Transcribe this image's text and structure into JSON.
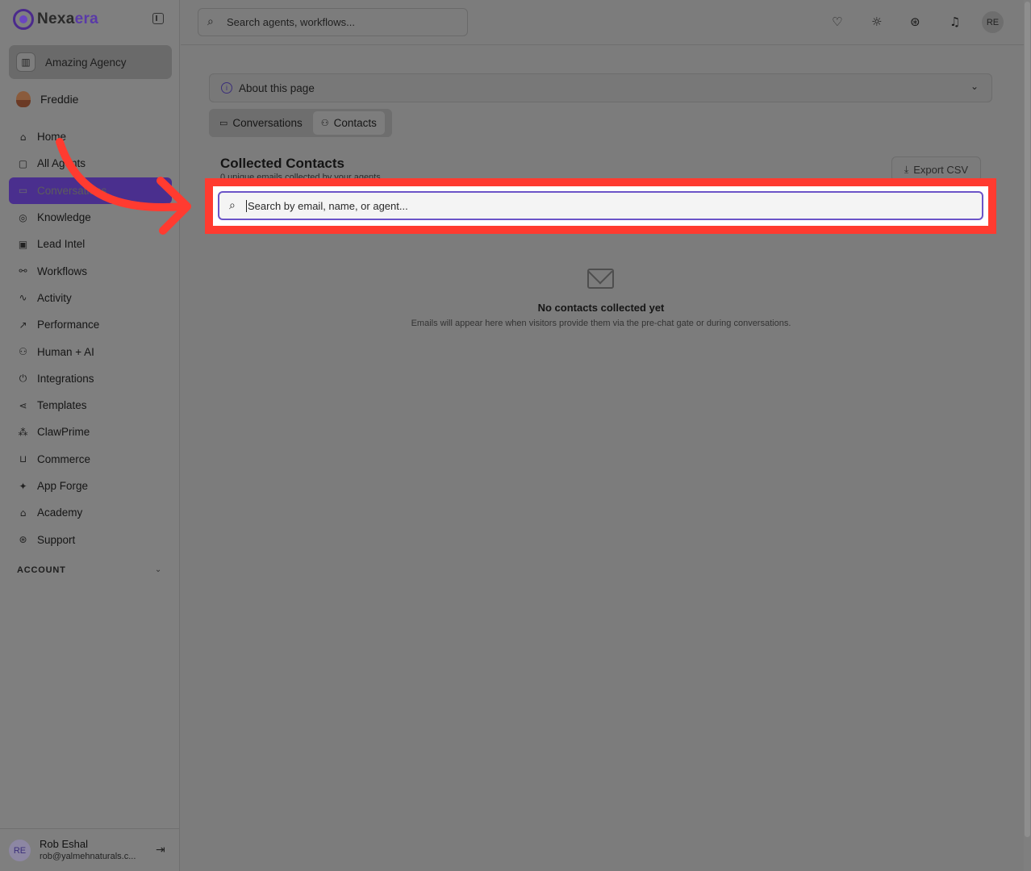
{
  "brand": {
    "name_start": "Nexa",
    "name_accent": "era"
  },
  "agency": {
    "label": "Amazing Agency"
  },
  "user": {
    "label": "Freddie"
  },
  "nav": [
    {
      "label": "Home",
      "icon": "home-icon",
      "glyph": "⌂"
    },
    {
      "label": "All Agents",
      "icon": "bot-icon",
      "glyph": "▢"
    },
    {
      "label": "Conversations",
      "icon": "chat-icon",
      "glyph": "▭"
    },
    {
      "label": "Knowledge",
      "icon": "globe-icon",
      "glyph": "◎"
    },
    {
      "label": "Lead Intel",
      "icon": "contact-card-icon",
      "glyph": "▣"
    },
    {
      "label": "Workflows",
      "icon": "workflow-icon",
      "glyph": "⚯"
    },
    {
      "label": "Activity",
      "icon": "activity-icon",
      "glyph": "∿"
    },
    {
      "label": "Performance",
      "icon": "trending-up-icon",
      "glyph": "↗"
    },
    {
      "label": "Human + AI",
      "icon": "network-icon",
      "glyph": "⚇"
    },
    {
      "label": "Integrations",
      "icon": "plug-icon",
      "glyph": "⏻"
    },
    {
      "label": "Templates",
      "icon": "share-icon",
      "glyph": "⋖"
    },
    {
      "label": "ClawPrime",
      "icon": "cluster-icon",
      "glyph": "⁂"
    },
    {
      "label": "Commerce",
      "icon": "cart-icon",
      "glyph": "⊔"
    },
    {
      "label": "App Forge",
      "icon": "sparkles-icon",
      "glyph": "✦"
    },
    {
      "label": "Academy",
      "icon": "graduation-cap-icon",
      "glyph": "⌂"
    },
    {
      "label": "Support",
      "icon": "life-buoy-icon",
      "glyph": "⊛"
    }
  ],
  "account": {
    "label": "ACCOUNT"
  },
  "profile": {
    "initials": "RE",
    "name": "Rob Eshal",
    "email": "rob@yalmehnaturals.c..."
  },
  "topbar": {
    "search_placeholder": "Search agents, workflows...",
    "avatar_initials": "RE"
  },
  "about": {
    "label": "About this page"
  },
  "tabs": [
    {
      "label": "Conversations",
      "icon": "chat-icon"
    },
    {
      "label": "Contacts",
      "icon": "users-icon"
    }
  ],
  "contacts": {
    "title": "Collected Contacts",
    "subtitle": "0 unique emails collected by your agents",
    "export_label": "Export CSV",
    "search_placeholder": "Search by email, name, or agent...",
    "empty_title": "No contacts collected yet",
    "empty_desc": "Emails will appear here when visitors provide them via the pre-chat gate or during conversations."
  },
  "colors": {
    "highlight": "#ff3b30",
    "accent": "#4a2f8e",
    "focus_ring": "#6b54c8"
  }
}
